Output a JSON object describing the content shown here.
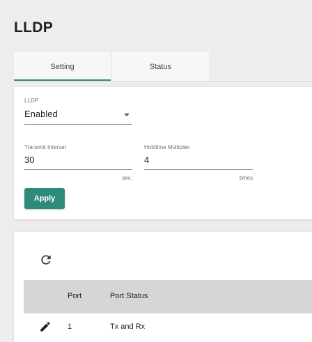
{
  "page": {
    "title": "LLDP"
  },
  "tabs": [
    {
      "label": "Setting",
      "active": true
    },
    {
      "label": "Status",
      "active": false
    }
  ],
  "settings": {
    "lldp": {
      "label": "LLDP",
      "value": "Enabled"
    },
    "transmit_interval": {
      "label": "Transmit Interval",
      "value": "30",
      "unit": "sec."
    },
    "holdtime_multiplier": {
      "label": "Holdtime Multiplier",
      "value": "4",
      "unit": "times"
    },
    "apply_label": "Apply"
  },
  "status": {
    "refresh_icon": "refresh-icon",
    "columns": [
      "Port",
      "Port Status"
    ],
    "rows": [
      {
        "port": "1",
        "port_status": "Tx and Rx",
        "action_icon": "edit-icon"
      }
    ]
  },
  "colors": {
    "accent": "#2e8a7b",
    "page_bg": "#ededed",
    "table_header_bg": "#d6d6d6"
  }
}
